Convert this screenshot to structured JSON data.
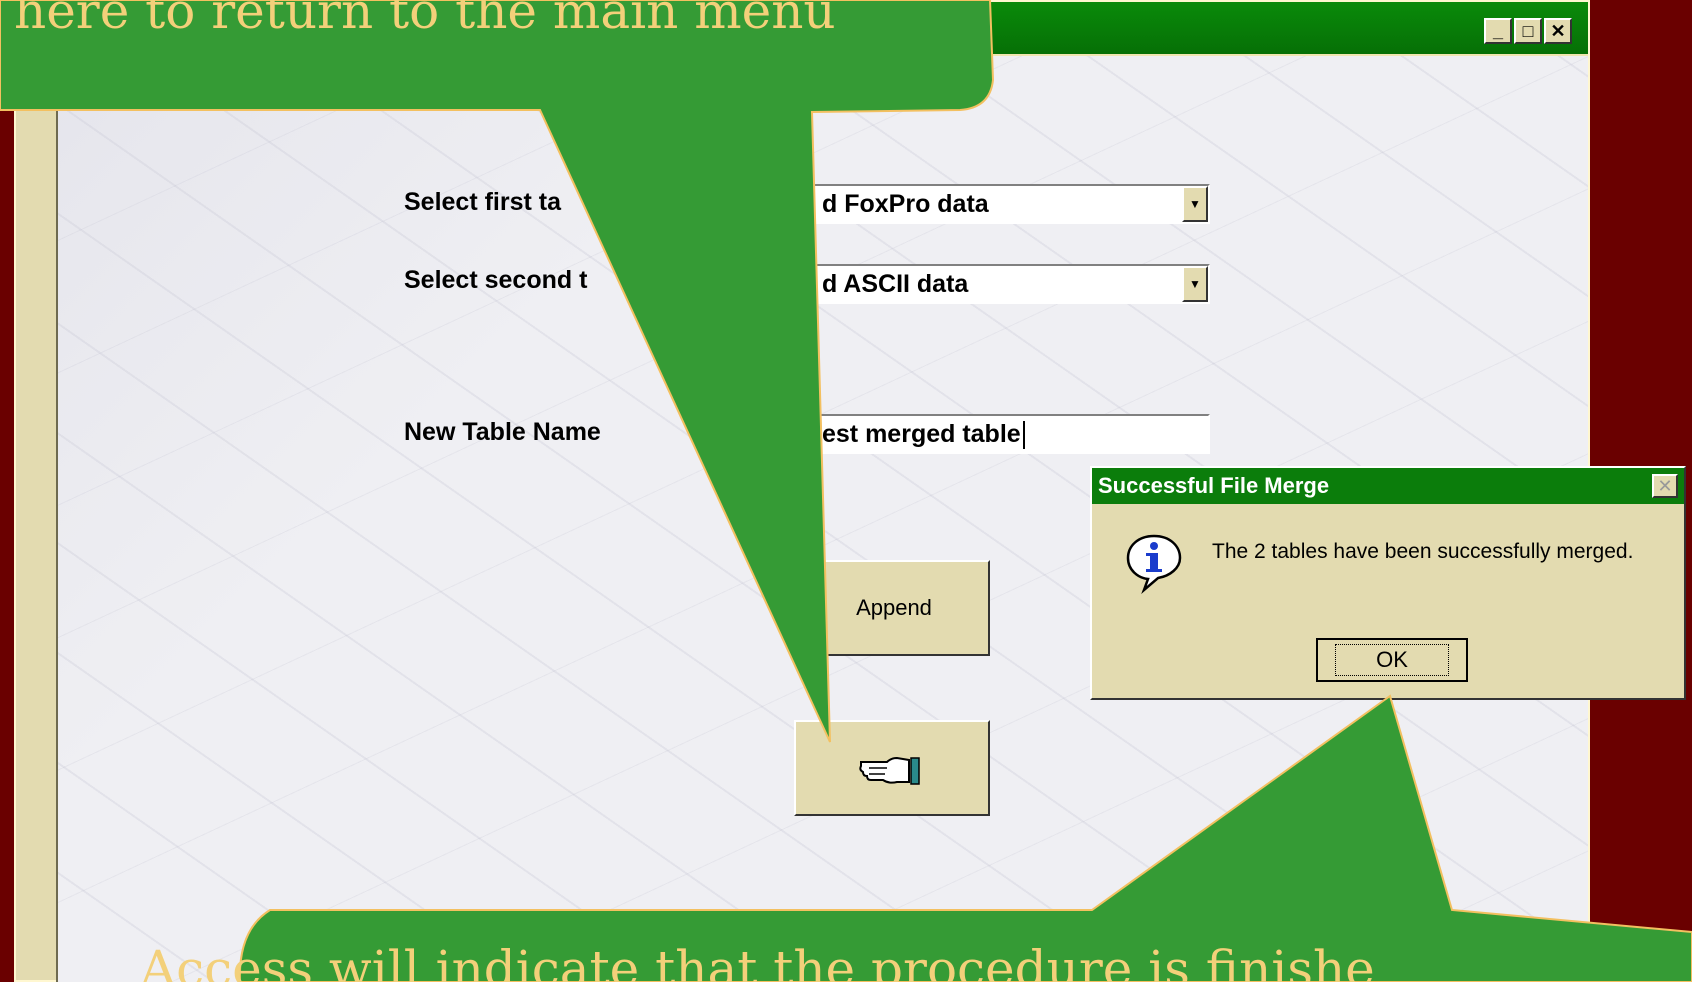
{
  "main_window": {
    "title_controls": [
      "_",
      "□",
      "✕"
    ]
  },
  "form": {
    "first_label": "Select first ta",
    "first_value": "d FoxPro data",
    "second_label": "Select second t",
    "second_value": "d ASCII data",
    "name_label": "New Table Name",
    "name_value": "est merged table",
    "append_label": "Append"
  },
  "msgbox": {
    "title": "Successful File Merge",
    "close": "✕",
    "message": "The 2 tables have been successfully merged.",
    "ok_label": "OK"
  },
  "callouts": {
    "top": "here to return to the main menu",
    "bottom": "Access will indicate that the procedure is finishe"
  },
  "colors": {
    "callout_fill": "#359b35",
    "callout_text": "#f3d07a",
    "title_green": "#0b7d0b",
    "window_face": "#e3dbb0",
    "background": "#6a0000"
  },
  "icons": {
    "hand": "pointing-hand-icon",
    "info": "info-icon"
  }
}
